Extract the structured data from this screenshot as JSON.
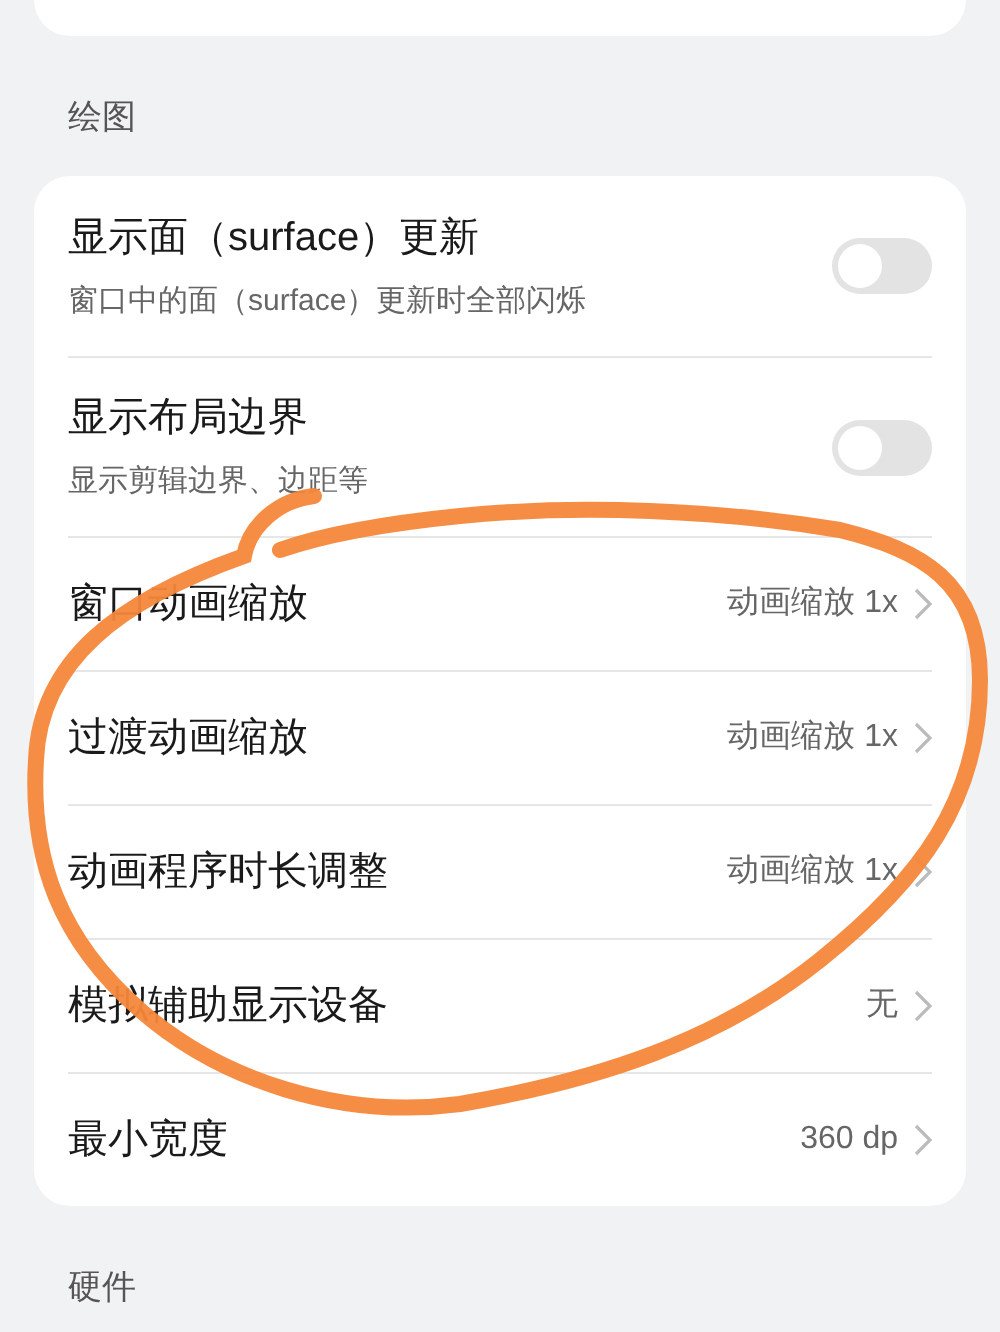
{
  "sections": [
    {
      "header": "绘图",
      "rows": [
        {
          "kind": "toggle",
          "title": "显示面（surface）更新",
          "subtitle": "窗口中的面（surface）更新时全部闪烁",
          "on": false
        },
        {
          "kind": "toggle",
          "title": "显示布局边界",
          "subtitle": "显示剪辑边界、边距等",
          "on": false
        },
        {
          "kind": "nav",
          "title": "窗口动画缩放",
          "value": "动画缩放 1x"
        },
        {
          "kind": "nav",
          "title": "过渡动画缩放",
          "value": "动画缩放 1x"
        },
        {
          "kind": "nav",
          "title": "动画程序时长调整",
          "value": "动画缩放 1x"
        },
        {
          "kind": "nav",
          "title": "模拟辅助显示设备",
          "value": "无"
        },
        {
          "kind": "nav",
          "title": "最小宽度",
          "value": "360 dp"
        }
      ]
    },
    {
      "header": "硬件"
    }
  ]
}
